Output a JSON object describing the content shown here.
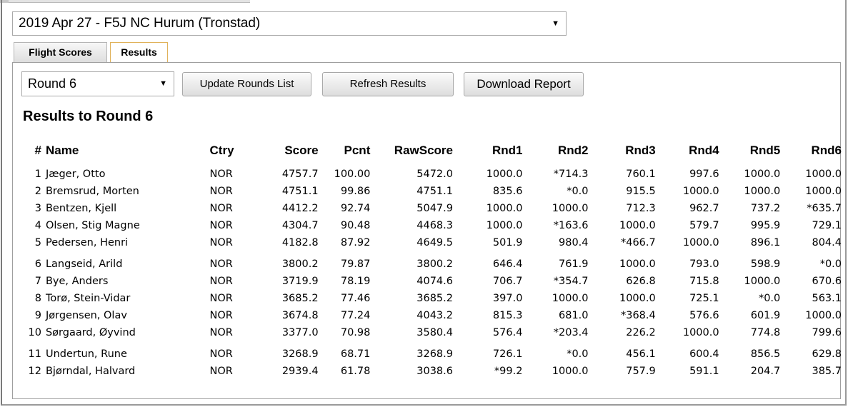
{
  "event": {
    "selected": "2019 Apr 27 - F5J NC Hurum (Tronstad)"
  },
  "tabs": [
    {
      "label": "Flight Scores"
    },
    {
      "label": "Results"
    }
  ],
  "round_select": {
    "selected": "Round 6"
  },
  "buttons": {
    "update_rounds": "Update Rounds List",
    "refresh_results": "Refresh Results",
    "download_report": "Download Report"
  },
  "results": {
    "heading": "Results to Round 6",
    "headers": [
      "#",
      "Name",
      "Ctry",
      "Score",
      "Pcnt",
      "RawScore",
      "Rnd1",
      "Rnd2",
      "Rnd3",
      "Rnd4",
      "Rnd5",
      "Rnd6"
    ],
    "rows": [
      [
        "1",
        "Jæger, Otto",
        "NOR",
        "4757.7",
        "100.00",
        "5472.0",
        "1000.0",
        "*714.3",
        "760.1",
        "997.6",
        "1000.0",
        "1000.0"
      ],
      [
        "2",
        "Bremsrud, Morten",
        "NOR",
        "4751.1",
        "99.86",
        "4751.1",
        "835.6",
        "*0.0",
        "915.5",
        "1000.0",
        "1000.0",
        "1000.0"
      ],
      [
        "3",
        "Bentzen, Kjell",
        "NOR",
        "4412.2",
        "92.74",
        "5047.9",
        "1000.0",
        "1000.0",
        "712.3",
        "962.7",
        "737.2",
        "*635.7"
      ],
      [
        "4",
        "Olsen, Stig Magne",
        "NOR",
        "4304.7",
        "90.48",
        "4468.3",
        "1000.0",
        "*163.6",
        "1000.0",
        "579.7",
        "995.9",
        "729.1"
      ],
      [
        "5",
        "Pedersen, Henri",
        "NOR",
        "4182.8",
        "87.92",
        "4649.5",
        "501.9",
        "980.4",
        "*466.7",
        "1000.0",
        "896.1",
        "804.4"
      ],
      [
        "6",
        "Langseid, Arild",
        "NOR",
        "3800.2",
        "79.87",
        "3800.2",
        "646.4",
        "761.9",
        "1000.0",
        "793.0",
        "598.9",
        "*0.0"
      ],
      [
        "7",
        "Bye, Anders",
        "NOR",
        "3719.9",
        "78.19",
        "4074.6",
        "706.7",
        "*354.7",
        "626.8",
        "715.8",
        "1000.0",
        "670.6"
      ],
      [
        "8",
        "Torø, Stein-Vidar",
        "NOR",
        "3685.2",
        "77.46",
        "3685.2",
        "397.0",
        "1000.0",
        "1000.0",
        "725.1",
        "*0.0",
        "563.1"
      ],
      [
        "9",
        "Jørgensen, Olav",
        "NOR",
        "3674.8",
        "77.24",
        "4043.2",
        "815.3",
        "681.0",
        "*368.4",
        "576.6",
        "601.9",
        "1000.0"
      ],
      [
        "10",
        "Sørgaard, Øyvind",
        "NOR",
        "3377.0",
        "70.98",
        "3580.4",
        "576.4",
        "*203.4",
        "226.2",
        "1000.0",
        "774.8",
        "799.6"
      ],
      [
        "11",
        "Undertun, Rune",
        "NOR",
        "3268.9",
        "68.71",
        "3268.9",
        "726.1",
        "*0.0",
        "456.1",
        "600.4",
        "856.5",
        "629.8"
      ],
      [
        "12",
        "Bjørndal, Halvard",
        "NOR",
        "2939.4",
        "61.78",
        "3038.6",
        "*99.2",
        "1000.0",
        "757.9",
        "591.1",
        "204.7",
        "385.7"
      ]
    ]
  },
  "icons": {
    "dropdown": "chevron-down-icon"
  }
}
